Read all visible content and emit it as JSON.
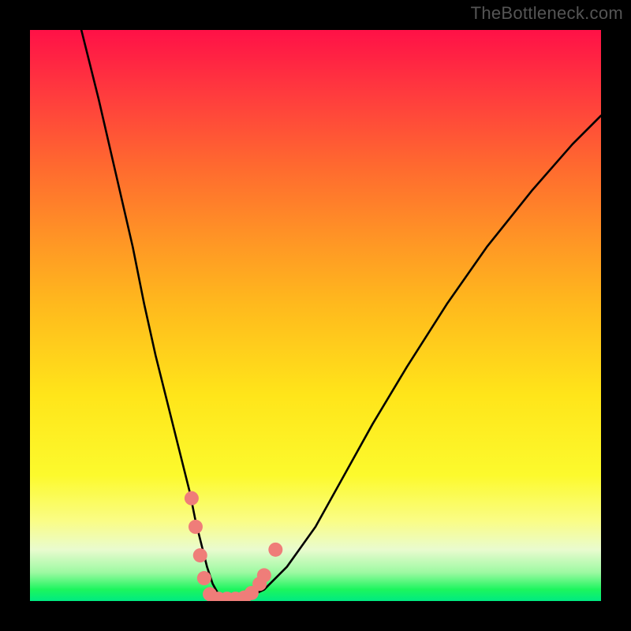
{
  "watermark": "TheBottleneck.com",
  "chart_data": {
    "type": "line",
    "title": "",
    "xlabel": "",
    "ylabel": "",
    "xlim": [
      0,
      100
    ],
    "ylim": [
      0,
      100
    ],
    "curve": {
      "name": "bottleneck-curve",
      "x": [
        9,
        12,
        15,
        18,
        20,
        22,
        24,
        26,
        28,
        29,
        30,
        31,
        32,
        33,
        34,
        36,
        38,
        41,
        45,
        50,
        55,
        60,
        66,
        73,
        80,
        88,
        95,
        100
      ],
      "y": [
        100,
        88,
        75,
        62,
        52,
        43,
        35,
        27,
        19,
        14,
        10,
        6,
        3,
        1.2,
        0.6,
        0.4,
        0.6,
        2,
        6,
        13,
        22,
        31,
        41,
        52,
        62,
        72,
        80,
        85
      ]
    },
    "markers": {
      "name": "highlight-dots",
      "color": "#ef7d79",
      "points": [
        {
          "x": 28.3,
          "y": 18
        },
        {
          "x": 29.0,
          "y": 13
        },
        {
          "x": 29.8,
          "y": 8
        },
        {
          "x": 30.5,
          "y": 4
        },
        {
          "x": 31.5,
          "y": 1.2
        },
        {
          "x": 33.0,
          "y": 0.4
        },
        {
          "x": 34.5,
          "y": 0.4
        },
        {
          "x": 36.0,
          "y": 0.4
        },
        {
          "x": 37.5,
          "y": 0.6
        },
        {
          "x": 38.8,
          "y": 1.4
        },
        {
          "x": 40.2,
          "y": 3.0
        },
        {
          "x": 41.0,
          "y": 4.5
        },
        {
          "x": 43.0,
          "y": 9.0
        }
      ]
    },
    "gradient_stops": [
      {
        "offset": 0,
        "color": "#ff1147"
      },
      {
        "offset": 12,
        "color": "#ff3e3d"
      },
      {
        "offset": 24,
        "color": "#ff6a2f"
      },
      {
        "offset": 37,
        "color": "#ff9625"
      },
      {
        "offset": 48,
        "color": "#ffb91d"
      },
      {
        "offset": 64,
        "color": "#ffe51a"
      },
      {
        "offset": 78,
        "color": "#fcfa2d"
      },
      {
        "offset": 86,
        "color": "#fafd86"
      },
      {
        "offset": 91,
        "color": "#e9fbcf"
      },
      {
        "offset": 95,
        "color": "#9df9a2"
      },
      {
        "offset": 98,
        "color": "#1cf55e"
      },
      {
        "offset": 100,
        "color": "#00ea82"
      }
    ]
  }
}
